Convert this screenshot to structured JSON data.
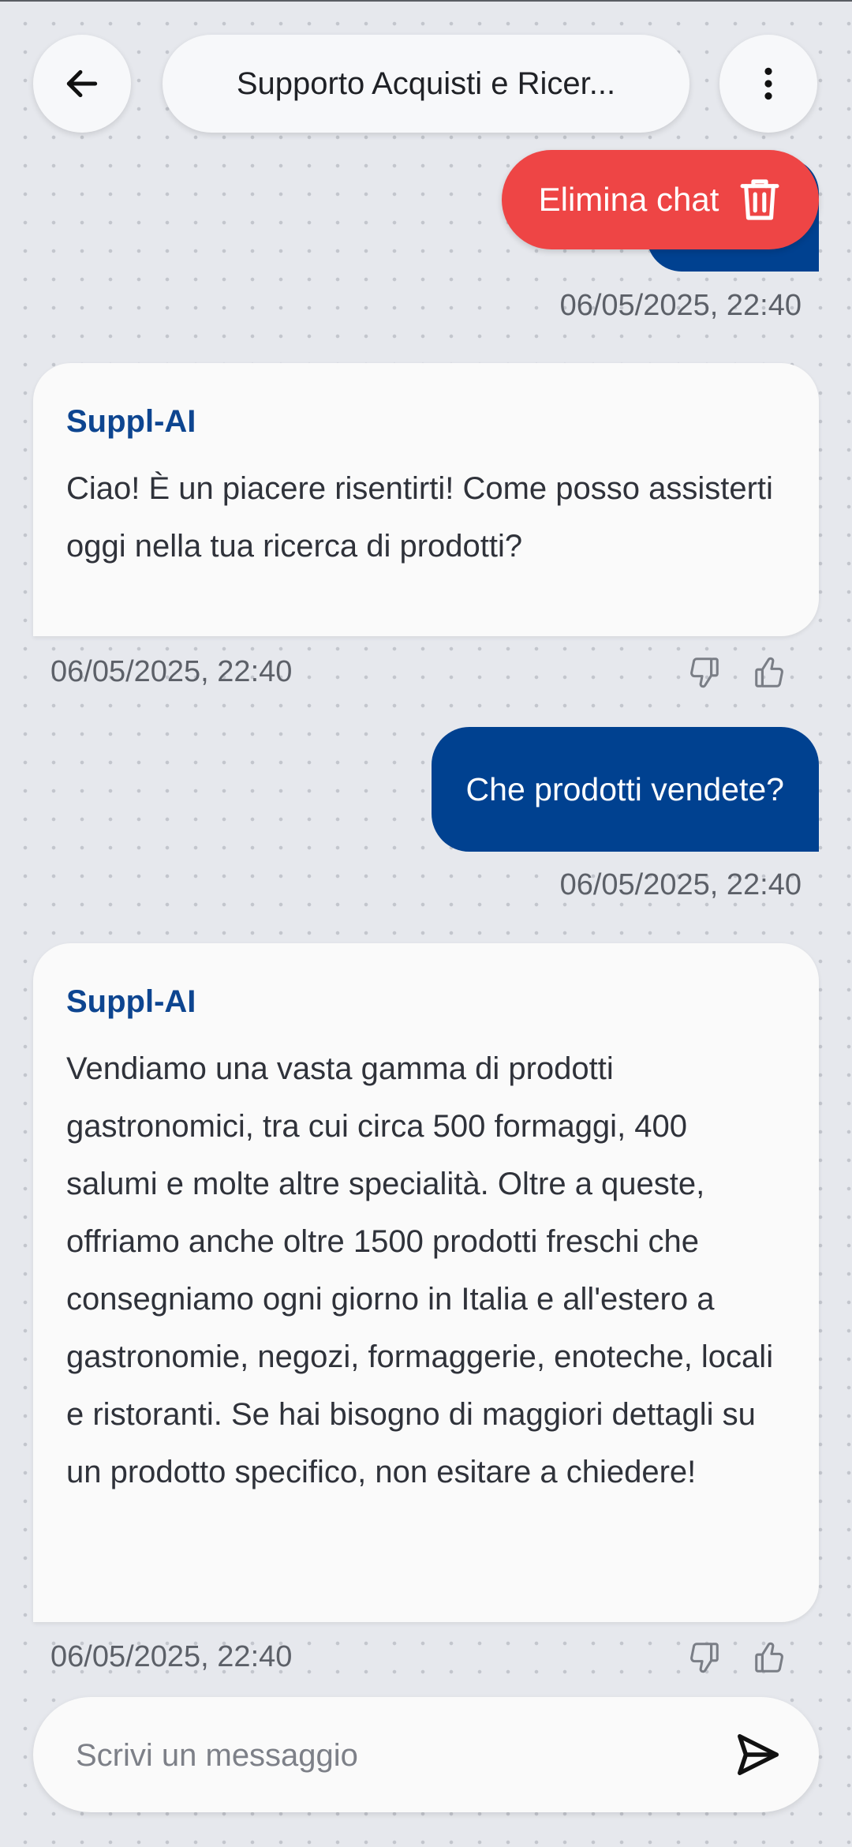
{
  "header": {
    "title": "Supporto Acquisti e Ricer...",
    "back_icon": "arrow-left-icon",
    "menu_icon": "more-vertical-icon"
  },
  "delete_action": {
    "label": "Elimina chat",
    "icon": "trash-icon",
    "color": "#ee4545"
  },
  "messages": [
    {
      "role": "user",
      "text": "",
      "timestamp": "06/05/2025, 22:40"
    },
    {
      "role": "bot",
      "sender": "Suppl-AI",
      "text": "Ciao! È un piacere risentirti! Come posso assisterti oggi nella tua ricerca di prodotti?",
      "timestamp": "06/05/2025, 22:40"
    },
    {
      "role": "user",
      "text": "Che prodotti vendete?",
      "timestamp": "06/05/2025, 22:40"
    },
    {
      "role": "bot",
      "sender": "Suppl-AI",
      "text": "Vendiamo una vasta gamma di prodotti gastronomici, tra cui circa 500 formaggi, 400 salumi e molte altre specialità. Oltre a queste, offriamo anche oltre 1500 prodotti freschi che consegniamo ogni giorno in Italia e all'estero a gastronomie, negozi, formaggerie, enoteche, locali e ristoranti. Se hai bisogno di maggiori dettagli su un prodotto specifico, non esitare a chiedere!",
      "timestamp": "06/05/2025, 22:40"
    }
  ],
  "feedback": {
    "dislike_icon": "thumbs-down-icon",
    "like_icon": "thumbs-up-icon"
  },
  "composer": {
    "placeholder": "Scrivi un messaggio",
    "value": "",
    "send_icon": "send-icon"
  },
  "colors": {
    "user_bubble": "#004190",
    "bot_name": "#0d4590",
    "background": "#e6e8ed"
  }
}
